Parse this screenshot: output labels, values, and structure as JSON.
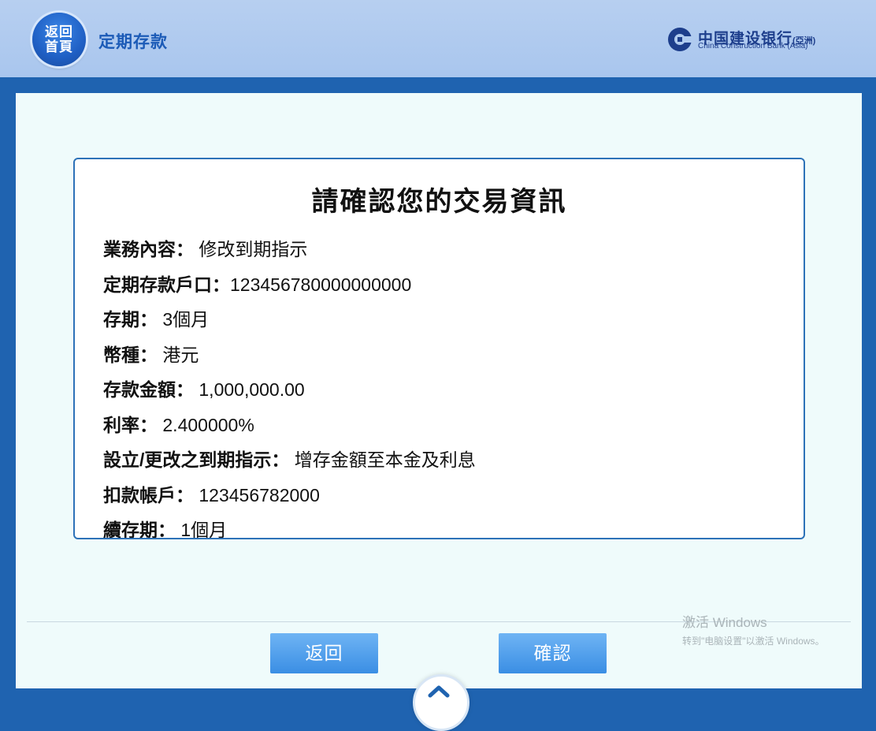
{
  "header": {
    "home_button_line1": "返回",
    "home_button_line2": "首頁",
    "page_title": "定期存款",
    "logo_cn": "中国建设银行",
    "logo_cn_suffix": "(亞洲)",
    "logo_en": "China Construction Bank (Asia)"
  },
  "confirm": {
    "title": "請確認您的交易資訊",
    "rows": [
      {
        "key": "業務內容：",
        "value": "修改到期指示"
      },
      {
        "key": "定期存款戶口：",
        "value": "123456780000000000"
      },
      {
        "key": "存期：",
        "value": "3個月"
      },
      {
        "key": "幣種：",
        "value": "港元"
      },
      {
        "key": "存款金額：",
        "value": "1,000,000.00"
      },
      {
        "key": "利率：",
        "value": "2.400000%"
      },
      {
        "key": "設立/更改之到期指示：",
        "value": "增存金額至本金及利息"
      },
      {
        "key": "扣款帳戶：",
        "value": "123456782000"
      },
      {
        "key": "續存期：",
        "value": "1個月"
      }
    ]
  },
  "actions": {
    "back_label": "返回",
    "confirm_label": "確認"
  },
  "watermark": {
    "line1": "激活 Windows",
    "line2": "转到\"电脑设置\"以激活 Windows。"
  },
  "icons": {
    "logo": "ccb-logo-icon",
    "scroll_up": "chevron-up-icon"
  },
  "colors": {
    "brand_blue": "#1c5bb7",
    "header_bg": "#a9c6ee",
    "panel_bg": "#effbfb",
    "button_bg": "#3a8ee4"
  }
}
